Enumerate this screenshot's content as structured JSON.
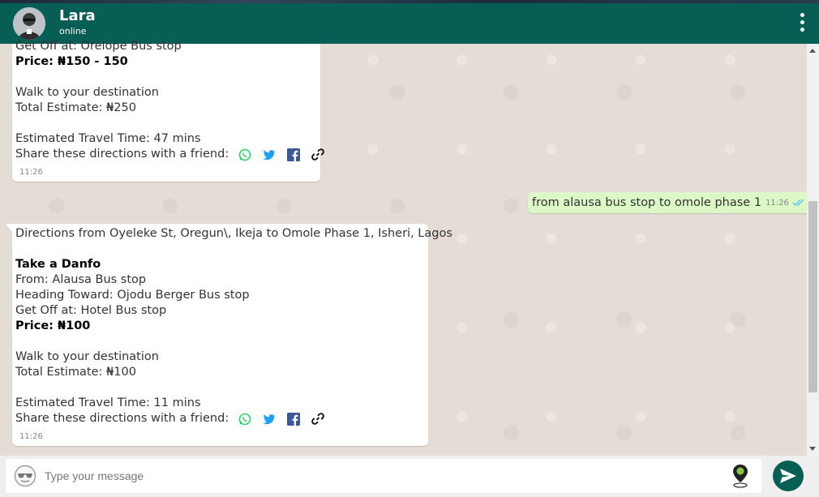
{
  "header": {
    "contact_name": "Lara",
    "contact_status": "online",
    "menu_icon": "kebab-menu-icon",
    "color": "#075e54"
  },
  "messages": {
    "first": {
      "lines": [
        "Get Off at: Orelope Bus stop"
      ],
      "price": "Price: ₦150 - 150",
      "walk": "Walk to your destination",
      "total": "Total Estimate: ₦250",
      "travel_time": "Estimated Travel Time: 47 mins",
      "share_label": "Share these directions with a friend:",
      "time": "11:26"
    },
    "outgoing": {
      "text": "from alausa bus stop to omole phase 1",
      "time": "11:26",
      "status_icon": "double-check-icon"
    },
    "second": {
      "directions": "Directions from Oyeleke St, Oregun\\, Ikeja to Omole Phase 1, Isheri, Lagos",
      "mode": "Take a Danfo",
      "from": "From: Alausa Bus stop",
      "heading": "Heading Toward: Ojodu Berger Bus stop",
      "get_off": "Get Off at: Hotel Bus stop",
      "price": "Price: ₦100",
      "walk": "Walk to your destination",
      "total": "Total Estimate: ₦100",
      "travel_time": "Estimated Travel Time: 11 mins",
      "share_label": "Share these directions with a friend:",
      "time": "11:26"
    }
  },
  "share_icons": [
    "whatsapp-icon",
    "twitter-icon",
    "facebook-icon",
    "link-icon"
  ],
  "composer": {
    "placeholder": "Type your message",
    "emoji_icon": "emoji-sunglasses-icon",
    "location_icon": "location-pin-icon",
    "send_icon": "send-icon"
  },
  "colors": {
    "chat_bg": "#e5ddd5",
    "outgoing_bubble": "#dcf8c6",
    "whatsapp_green": "#25d366",
    "twitter_blue": "#1da1f2",
    "facebook_blue": "#3b5998"
  }
}
